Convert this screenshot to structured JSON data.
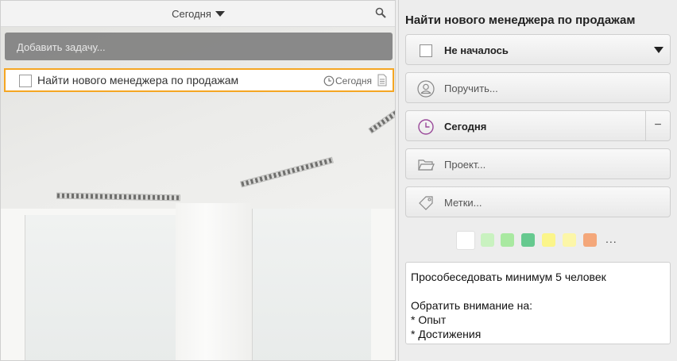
{
  "list": {
    "filter_label": "Сегодня",
    "add_placeholder": "Добавить задачу...",
    "tasks": [
      {
        "title": "Найти нового менеджера по продажам",
        "due": "Сегодня",
        "completed": false,
        "has_note": true
      }
    ],
    "selection_color": "#f5a623"
  },
  "detail": {
    "title": "Найти нового менеджера по продажам",
    "status": "Не началось",
    "assign_placeholder": "Поручить...",
    "due": "Сегодня",
    "due_clear": "−",
    "project_placeholder": "Проект...",
    "tags_placeholder": "Метки...",
    "colors": [
      "#ffffff",
      "#c9f2c0",
      "#a9e9a1",
      "#66c98f",
      "#fbf58a",
      "#fcf6a8",
      "#f4a77a"
    ],
    "colors_more": "...",
    "note": "Прособеседовать минимум 5 человек\n\nОбратить внимание на:\n* Опыт\n* Достижения"
  }
}
